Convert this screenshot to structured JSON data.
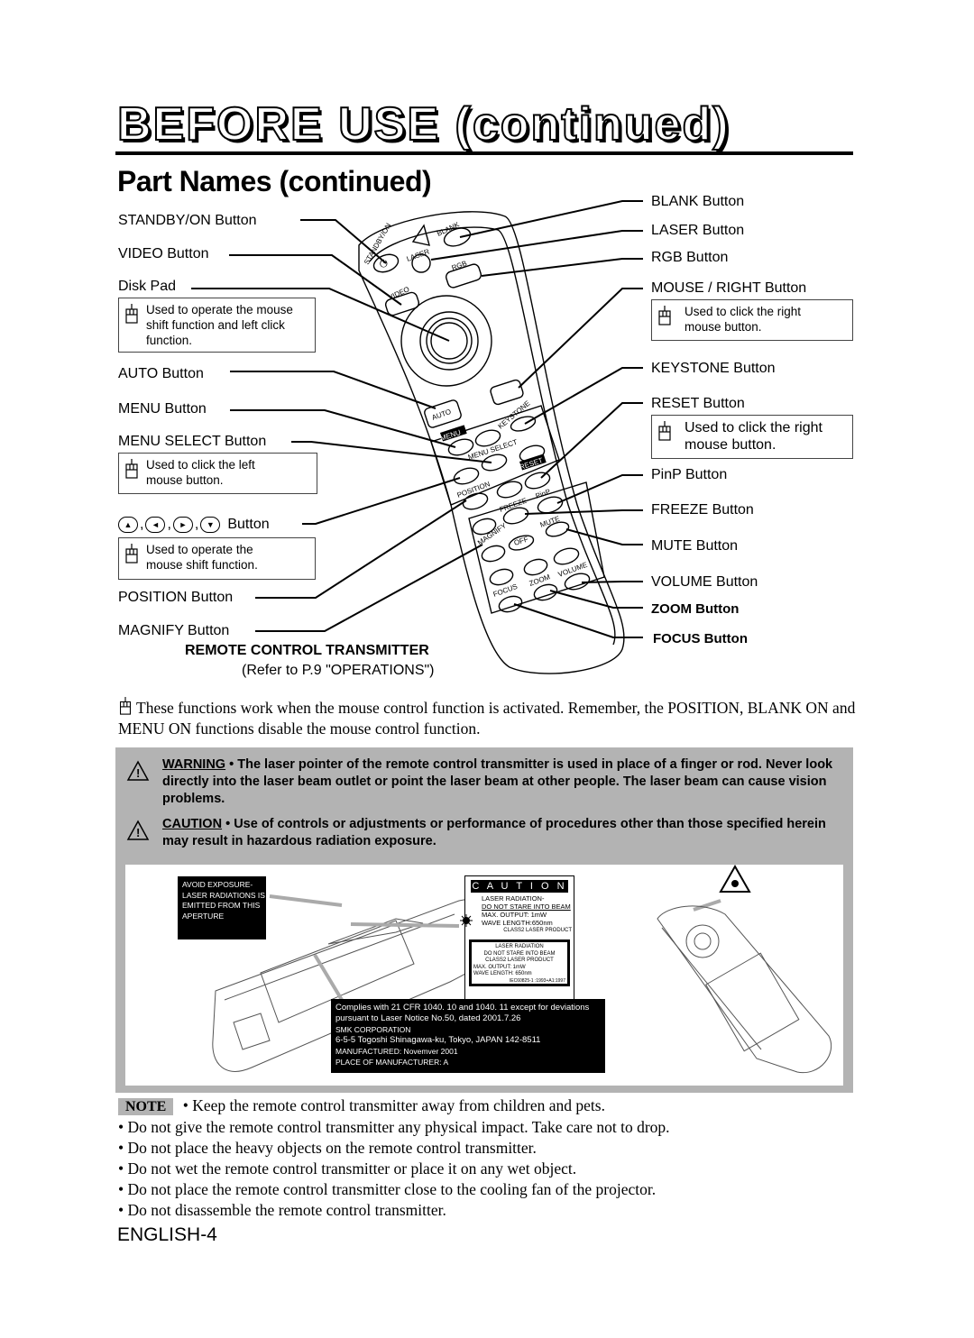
{
  "header": {
    "title": "BEFORE USE (continued)",
    "subtitle": "Part Names (continued)"
  },
  "left_labels": [
    {
      "id": "standby",
      "text": "STANDBY/ON Button"
    },
    {
      "id": "video",
      "text": "VIDEO Button"
    },
    {
      "id": "disk",
      "text": "Disk Pad"
    },
    {
      "id": "auto",
      "text": "AUTO Button"
    },
    {
      "id": "menu",
      "text": "MENU Button"
    },
    {
      "id": "menu_select",
      "text": "MENU SELECT Button"
    },
    {
      "id": "arrows",
      "text": "Button"
    },
    {
      "id": "position",
      "text": "POSITION Button"
    },
    {
      "id": "magnify",
      "text": "MAGNIFY Button"
    }
  ],
  "right_labels": [
    {
      "id": "blank",
      "text": "BLANK Button"
    },
    {
      "id": "laser",
      "text": "LASER Button"
    },
    {
      "id": "rgb",
      "text": "RGB Button"
    },
    {
      "id": "mouse_right",
      "text": "MOUSE / RIGHT Button"
    },
    {
      "id": "keystone",
      "text": "KEYSTONE Button"
    },
    {
      "id": "reset",
      "text": "RESET Button"
    },
    {
      "id": "pinp",
      "text": "PinP Button"
    },
    {
      "id": "freeze",
      "text": "FREEZE Button"
    },
    {
      "id": "mute",
      "text": "MUTE Button"
    },
    {
      "id": "volume",
      "text": "VOLUME Button"
    },
    {
      "id": "zoom",
      "text": "ZOOM Button"
    },
    {
      "id": "focus",
      "text": "FOCUS Button"
    }
  ],
  "mouse_notes": {
    "disk": "Used to operate the mouse shift function and left click function.",
    "menu_select": "Used to click the left mouse button.",
    "arrows": "Used to operate the mouse shift function.",
    "mouse_right": "Used to click the right mouse button.",
    "reset": "Used to click the right mouse button."
  },
  "arrow_glyphs": [
    "▲",
    "◄",
    "►",
    "▼"
  ],
  "remote_keys": {
    "standby": "STANDBY/ON",
    "laser": "LASER",
    "blank": "BLANK",
    "rgb": "RGB",
    "video": "VIDEO",
    "auto": "AUTO",
    "keystone": "KEYSTONE",
    "menu": "MENU",
    "menu_select": "MENU SELECT",
    "reset": "RESET",
    "position": "POSITION",
    "pinp": "PinP",
    "freeze": "FREEZE",
    "mute": "MUTE",
    "magnify": "MAGNIFY",
    "off": "OFF",
    "volume": "VOLUME",
    "zoom": "ZOOM",
    "focus": "FOCUS"
  },
  "transmitter": {
    "title": "REMOTE CONTROL TRANSMITTER",
    "ref": "(Refer to P.9 \"OPERATIONS\")"
  },
  "mouse_paragraph": "These functions work when the mouse control function is activated. Remember, the POSITION, BLANK ON and MENU ON functions disable the mouse control function.",
  "warning": {
    "label": "WARNING",
    "text": "• The laser pointer of the remote control transmitter is used in place of a finger or rod. Never look directly into the laser beam outlet or point the laser beam at other people. The laser beam can cause vision problems."
  },
  "caution": {
    "label": "CAUTION",
    "text": "• Use of controls or adjustments or performance of procedures other than those specified herein may result in hazardous radiation exposure."
  },
  "labels_figure": {
    "aperture_lines": [
      "AVOID  EXPOSURE-",
      "LASER RADIATIONS IS",
      "EMITTED  FROM  THIS",
      "APERTURE"
    ],
    "caution_title": "C A U T I O N",
    "caution_lines": [
      "LASER  RADIATION-",
      "DO NOT STARE INTO BEAM",
      "MAX. OUTPUT:  1mW",
      "WAVE LENGTH:650nm"
    ],
    "caution_class": "CLASS2 LASER PRODUCT",
    "inner_lines": [
      "LASER RADIATION",
      "DO NOT STARE INTO BEAM",
      "CLASS2 LASER PRODUCT"
    ],
    "inner_left_lines": [
      "MAX.  OUTPUT:  1mW",
      "WAVE LENGTH:  650nm"
    ],
    "inner_iec": "IEC60825-1 :1993+A1:1997",
    "compliance_lines": [
      "Complies with 21 CFR 1040. 10 and 1040. 11 except for deviations",
      "pursuant  to  Laser  Notice  No.50,  dated  2001.7.26",
      "SMK CORPORATION",
      "6-5-5  Togoshi  Shinagawa-ku,  Tokyo,  JAPAN  142-8511",
      "MANUFACTURED: Novemver  2001",
      "PLACE  OF  MANUFACTURER:  A"
    ]
  },
  "note": {
    "tag": "NOTE",
    "items": [
      "• Keep the remote control transmitter away from children and pets.",
      "• Do not give the remote control transmitter any physical impact. Take care not to drop.",
      "• Do not place the heavy objects on the remote control transmitter.",
      "• Do not wet the remote control transmitter or place it on any wet object.",
      "• Do not place the remote control transmitter close to the cooling fan of the projector.",
      "• Do not disassemble the remote control transmitter."
    ]
  },
  "footer": {
    "page": "ENGLISH-4"
  }
}
